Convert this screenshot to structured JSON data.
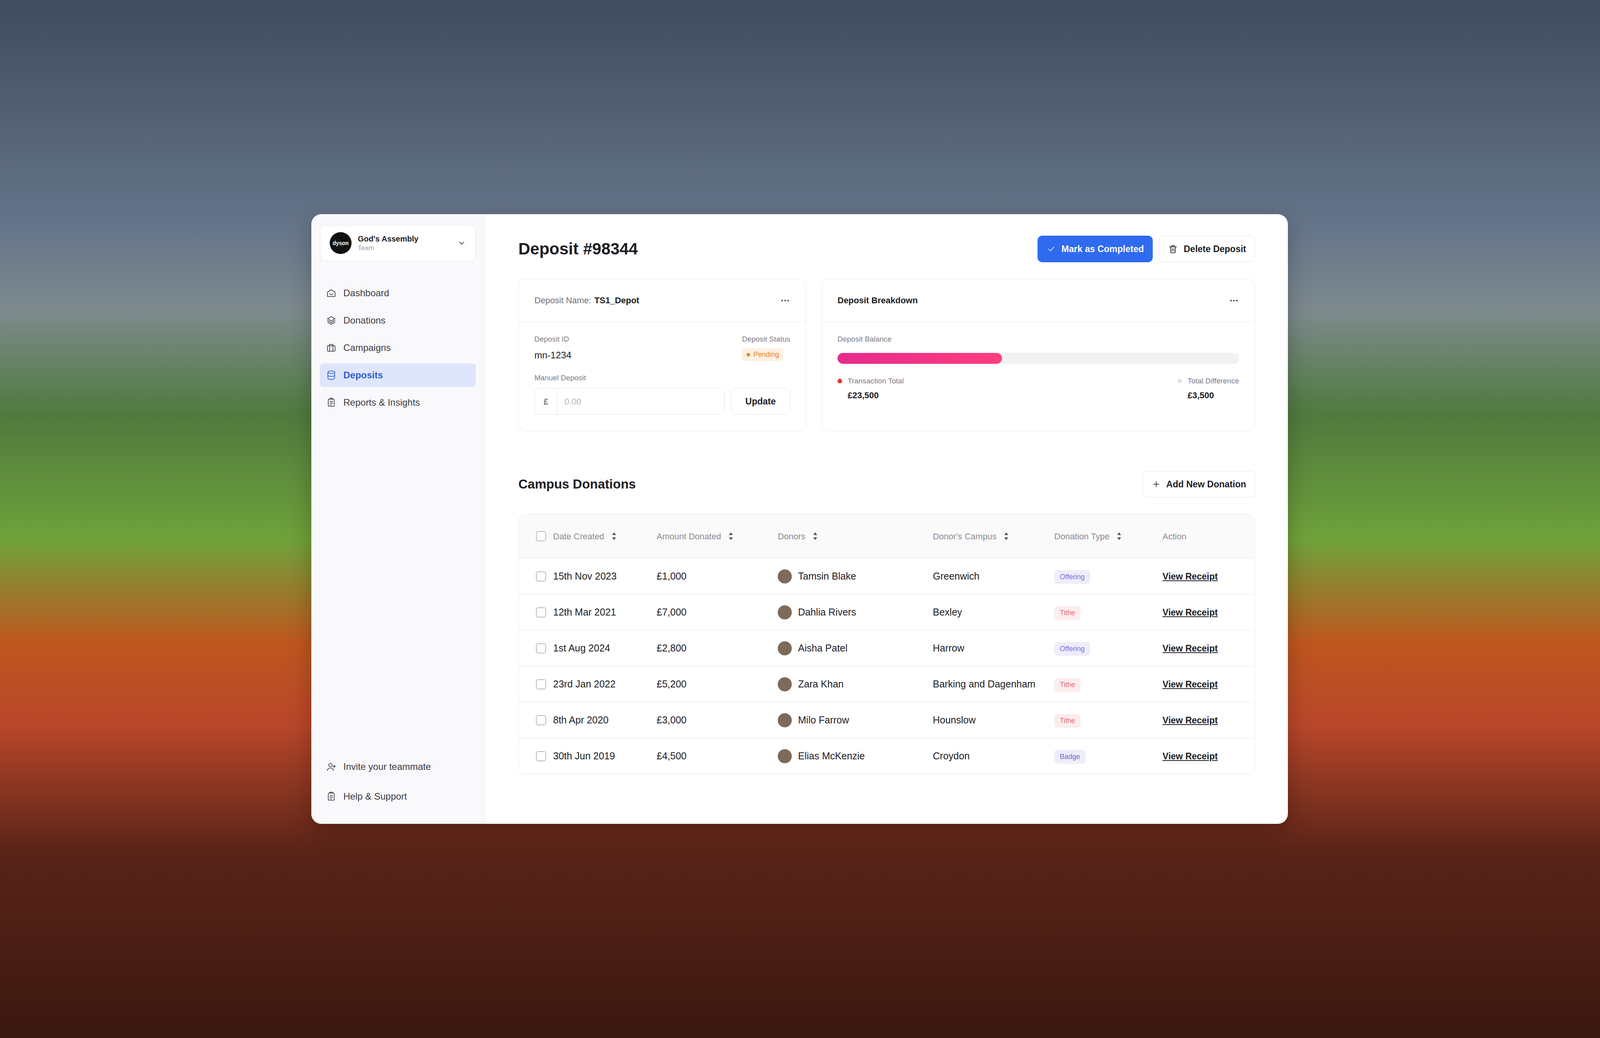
{
  "team": {
    "logo": "dyson",
    "name": "God's Assembly",
    "role": "Team"
  },
  "sidebar": {
    "items": [
      {
        "label": "Dashboard",
        "selected": false
      },
      {
        "label": "Donations",
        "selected": false
      },
      {
        "label": "Campaigns",
        "selected": false
      },
      {
        "label": "Deposits",
        "selected": true
      },
      {
        "label": "Reports & Insights",
        "selected": false
      }
    ],
    "footer": [
      {
        "label": "Invite your teammate"
      },
      {
        "label": "Help & Support"
      }
    ]
  },
  "page": {
    "title": "Deposit #98344",
    "complete_button": "Mark as Completed",
    "delete_button": "Delete Deposit"
  },
  "deposit": {
    "name_label": "Deposit Name:",
    "name": "TS1_Depot",
    "id_label": "Deposit ID",
    "id": "mn-1234",
    "status_label": "Deposit Status",
    "status": "Pending",
    "manual_label": "Manuel Deposit",
    "currency": "£",
    "placeholder": "0.00",
    "update_button": "Update"
  },
  "breakdown": {
    "title": "Deposit Breakdown",
    "balance_label": "Deposit Balance",
    "level": 0.41,
    "legend": [
      {
        "label": "Transaction Total",
        "value": "£23,500",
        "color": "#e5333b"
      },
      {
        "label": "Total Difference",
        "value": "£3,500",
        "color": "#e4e4e8"
      }
    ]
  },
  "donations": {
    "title": "Campus Donations",
    "add_button": "Add New Donation",
    "all_checked": false,
    "columns": [
      {
        "label": "Date Created",
        "sortable": true
      },
      {
        "label": "Amount Donated",
        "sortable": true
      },
      {
        "label": "Donors",
        "sortable": true
      },
      {
        "label": "Donor's Campus",
        "sortable": true
      },
      {
        "label": "Donation Type",
        "sortable": true
      },
      {
        "label": "Action",
        "sortable": false
      }
    ],
    "rows": [
      {
        "checked": false,
        "date": "15th Nov 2023",
        "amount": "£1,000",
        "donor": "Tamsin Blake",
        "campus": "Greenwich",
        "type": "Offering",
        "type_color": "#7b6fd6",
        "action": "View Receipt"
      },
      {
        "checked": false,
        "date": "12th Mar 2021",
        "amount": "£7,000",
        "donor": "Dahlia Rivers",
        "campus": "Bexley",
        "type": "Tithe",
        "type_color": "#e36a6a",
        "action": "View Receipt"
      },
      {
        "checked": false,
        "date": "1st Aug 2024",
        "amount": "£2,800",
        "donor": "Aisha Patel",
        "campus": "Harrow",
        "type": "Offering",
        "type_color": "#7b6fd6",
        "action": "View Receipt"
      },
      {
        "checked": false,
        "date": "23rd Jan 2022",
        "amount": "£5,200",
        "donor": "Zara Khan",
        "campus": "Barking and Dagenham",
        "type": "Tithe",
        "type_color": "#e36a6a",
        "action": "View Receipt"
      },
      {
        "checked": false,
        "date": "8th Apr 2020",
        "amount": "£3,000",
        "donor": "Milo Farrow",
        "campus": "Hounslow",
        "type": "Tithe",
        "type_color": "#e36a6a",
        "action": "View Receipt"
      },
      {
        "checked": false,
        "date": "30th Jun 2019",
        "amount": "£4,500",
        "donor": "Elias McKenzie",
        "campus": "Croydon",
        "type": "Badge",
        "type_color": "#6b6bd6",
        "action": "View Receipt"
      }
    ]
  }
}
